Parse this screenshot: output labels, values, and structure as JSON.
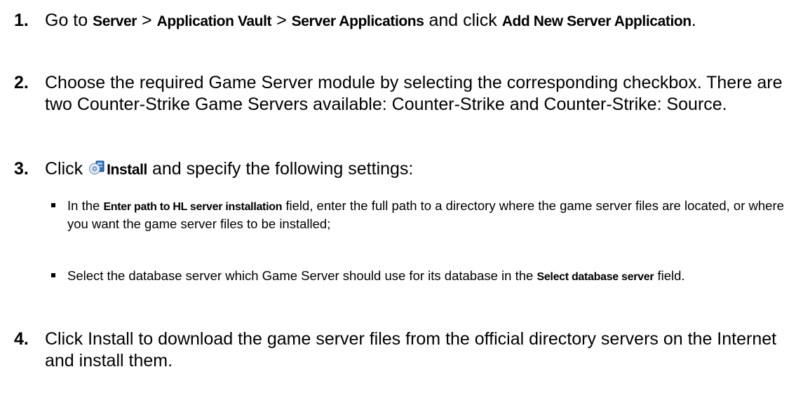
{
  "steps": [
    {
      "number": "1.",
      "t1": "Go to ",
      "b1": "Server",
      "t2": " > ",
      "b2": "Application Vault",
      "t3": " > ",
      "b3": "Server Applications",
      "t4": " and click ",
      "b4": "Add New Server Application",
      "t5": "."
    },
    {
      "number": "2.",
      "text": "Choose the required Game Server module by selecting the corresponding checkbox. There are two Counter-Strike Game Servers available: Counter-Strike and Counter-Strike: Source."
    },
    {
      "number": "3.",
      "t1": "Click ",
      "icon": "install-icon",
      "b1": "Install",
      "t2": " and specify the following settings:"
    },
    {
      "number": "4.",
      "text": "Click Install to download the game server files from the official directory servers on the Internet and install them."
    }
  ],
  "bullets": [
    {
      "t1": "In the ",
      "b1": "Enter path to HL server installation",
      "t2": " field, enter the full path to a directory where the game server files are located, or where you want the game server files to be installed;"
    },
    {
      "t1": "Select the database server which Game Server should use for its database in the ",
      "b1": "Select database server",
      "t2": " field."
    }
  ]
}
